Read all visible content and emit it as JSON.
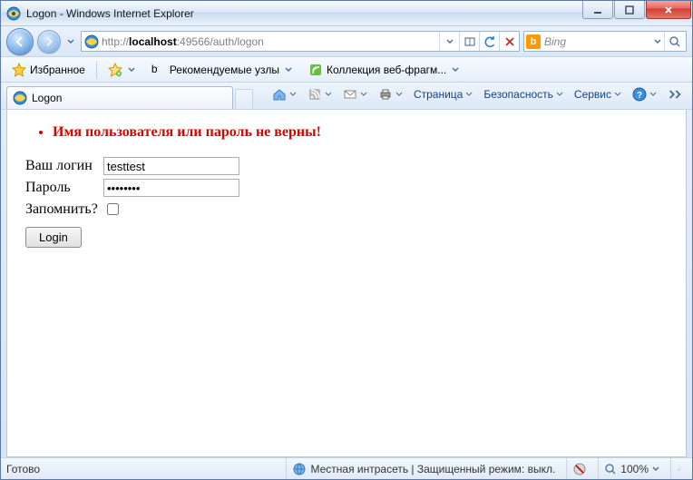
{
  "titlebar": {
    "title": "Logon - Windows Internet Explorer"
  },
  "nav": {
    "url_prefix": "http://",
    "url_host": "localhost",
    "url_rest": ":49566/auth/logon",
    "search_placeholder": "Bing"
  },
  "favbar": {
    "favorites_label": "Избранное",
    "recommended_label": "Рекомендуемые узлы",
    "webfrag_label": "Коллекция веб-фрагм..."
  },
  "tab": {
    "label": "Logon"
  },
  "cmd": {
    "page": "Страница",
    "safety": "Безопасность",
    "service": "Сервис"
  },
  "page": {
    "error_msg": "Имя пользователя или пароль не верны!",
    "login_label": "Ваш логин",
    "login_value": "testtest",
    "password_label": "Пароль",
    "password_value": "••••••••",
    "remember_label": "Запомнить?",
    "submit_label": "Login"
  },
  "status": {
    "ready": "Готово",
    "zone": "Местная интрасеть | Защищенный режим: выкл.",
    "zoom": "100%"
  }
}
